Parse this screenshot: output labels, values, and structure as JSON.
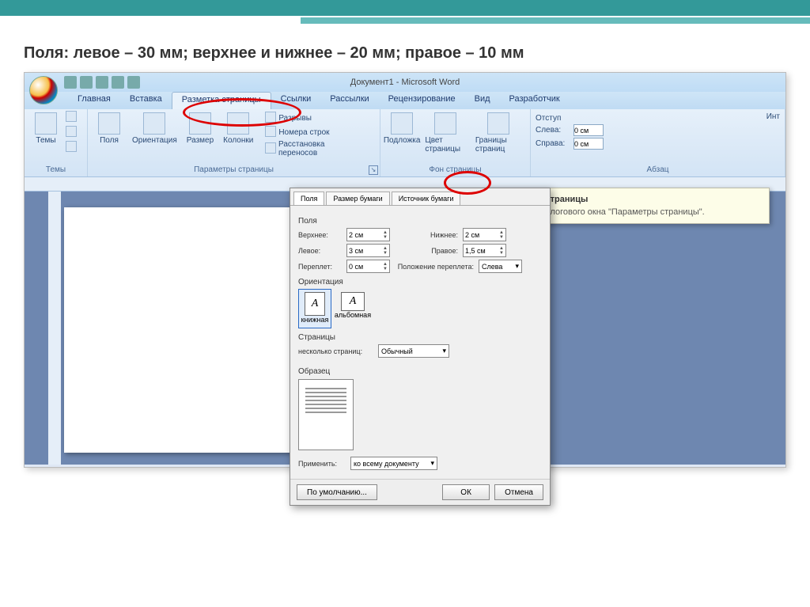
{
  "slide": {
    "title": "Поля: левое – 30 мм; верхнее и нижнее – 20 мм; правое – 10 мм"
  },
  "app": {
    "title": "Документ1 - Microsoft Word"
  },
  "tabs": {
    "home": "Главная",
    "insert": "Вставка",
    "layout": "Разметка страницы",
    "refs": "Ссылки",
    "mail": "Рассылки",
    "review": "Рецензирование",
    "view": "Вид",
    "dev": "Разработчик"
  },
  "groups": {
    "themes": "Темы",
    "themes_btn": "Темы",
    "pagesetup": "Параметры страницы",
    "margins": "Поля",
    "orient": "Ориентация",
    "size": "Размер",
    "columns": "Колонки",
    "breaks": "Разрывы",
    "linenum": "Номера строк",
    "hyphen": "Расстановка переносов",
    "pagebg": "Фон страницы",
    "watermark": "Подложка",
    "pagecolor": "Цвет страницы",
    "borders": "Границы страниц",
    "para": "Абзац",
    "indent": "Отступ",
    "left": "Слева:",
    "right": "Справа:",
    "v0": "0 см",
    "int": "Инт"
  },
  "tooltip": {
    "title": "Параметры страницы",
    "body": "Открытие диалогового окна \"Параметры страницы\"."
  },
  "dialog": {
    "tabs": {
      "margins": "Поля",
      "paper": "Размер бумаги",
      "source": "Источник бумаги"
    },
    "section_margins": "Поля",
    "top": "Верхнее:",
    "top_v": "2 см",
    "bottom": "Нижнее:",
    "bottom_v": "2 см",
    "left": "Левое:",
    "left_v": "3 см",
    "right": "Правое:",
    "right_v": "1,5 см",
    "gutter": "Переплет:",
    "gutter_v": "0 см",
    "gutterpos": "Положение переплета:",
    "gutterpos_v": "Слева",
    "section_orient": "Ориентация",
    "portrait": "книжная",
    "landscape": "альбомная",
    "section_pages": "Страницы",
    "multi": "несколько страниц:",
    "multi_v": "Обычный",
    "section_preview": "Образец",
    "apply": "Применить:",
    "apply_v": "ко всему документу",
    "defaults": "По умолчанию...",
    "ok": "ОК",
    "cancel": "Отмена"
  }
}
